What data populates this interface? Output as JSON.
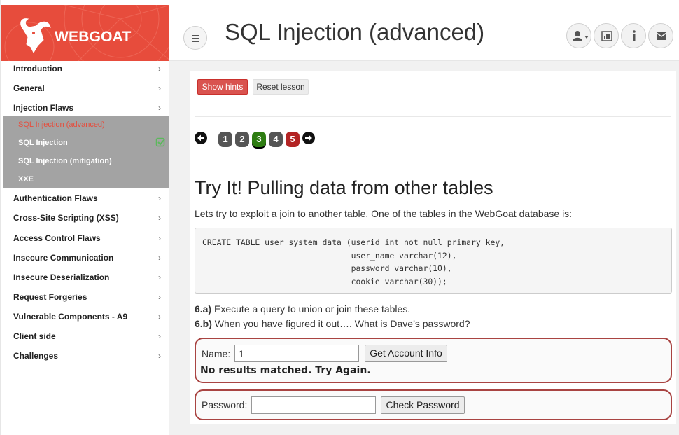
{
  "brand": {
    "name": "WEBGOAT",
    "color": "#e74c3c"
  },
  "header": {
    "title": "SQL Injection (advanced)",
    "icons": [
      "user-menu-icon",
      "bar-chart-icon",
      "info-icon",
      "envelope-icon"
    ]
  },
  "sidebar": {
    "categories": [
      {
        "label": "Introduction"
      },
      {
        "label": "General"
      },
      {
        "label": "Injection Flaws"
      },
      {
        "label": "Authentication Flaws"
      },
      {
        "label": "Cross-Site Scripting (XSS)"
      },
      {
        "label": "Access Control Flaws"
      },
      {
        "label": "Insecure Communication"
      },
      {
        "label": "Insecure Deserialization"
      },
      {
        "label": "Request Forgeries"
      },
      {
        "label": "Vulnerable Components - A9"
      },
      {
        "label": "Client side"
      },
      {
        "label": "Challenges"
      }
    ],
    "injection_items": [
      {
        "label": "SQL Injection (advanced)"
      },
      {
        "label": "SQL Injection"
      },
      {
        "label": "SQL Injection (mitigation)"
      },
      {
        "label": "XXE"
      }
    ]
  },
  "toolbar": {
    "show_hints": "Show hints",
    "reset_lesson": "Reset lesson"
  },
  "pagination": {
    "pages": [
      {
        "label": "1",
        "color": "#555555"
      },
      {
        "label": "2",
        "color": "#555555"
      },
      {
        "label": "3",
        "color": "#2e7d12"
      },
      {
        "label": "4",
        "color": "#555555"
      },
      {
        "label": "5",
        "color": "#b32424"
      }
    ]
  },
  "content": {
    "title": "Try It! Pulling data from other tables",
    "intro": "Lets try to exploit a join to another table. One of the tables in the WebGoat database is:",
    "code": "CREATE TABLE user_system_data (userid int not null primary key,\n                               user_name varchar(12),\n                               password varchar(10),\n                               cookie varchar(30));",
    "step_a_label": "6.a)",
    "step_a_text": " Execute a query to union or join these tables.",
    "step_b_label": "6.b)",
    "step_b_text": " When you have figured it out…. What is Dave’s password?"
  },
  "form1": {
    "name_label": "Name:",
    "name_value": "1",
    "button": "Get Account Info",
    "feedback": "No results matched. Try Again."
  },
  "form2": {
    "password_label": "Password:",
    "password_value": "",
    "button": "Check Password"
  }
}
